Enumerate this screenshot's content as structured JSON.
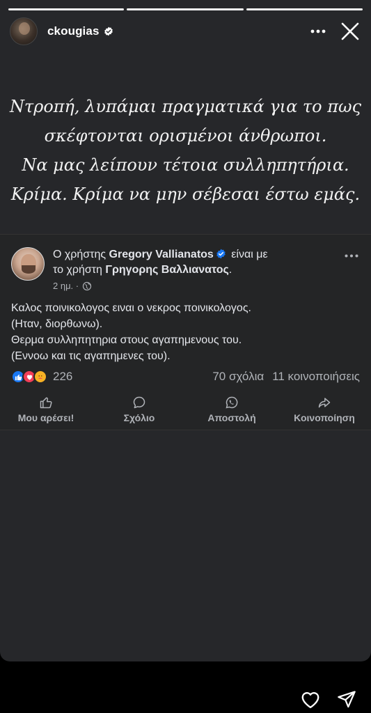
{
  "story": {
    "username": "ckougias",
    "progress_total": 3,
    "progress_current": 3,
    "text_lines": [
      "Ντροπή, λυπάμαι πραγματικά για το πως",
      "σκέφτονται ορισμένοι άνθρωποι.",
      "Να μας λείπουν τέτοια συλληπητήρια.",
      "Κρίμα. Κρίμα να μην σέβεσαι έστω εμάς."
    ]
  },
  "post": {
    "head_prefix": "Ο χρήστης",
    "author": "Gregory Vallianatos",
    "head_mid": "είναι με",
    "head_line2_prefix": "το χρήστη",
    "tagged": "Γρηγορης Βαλλιανατος",
    "head_suffix": ".",
    "time": "2 ημ. ·",
    "body_lines": [
      "Καλος ποινικολογος ειναι ο νεκρος ποινικολογος.",
      "(Ηταν, διορθωνω).",
      "Θερμα συλληπητηρια στους αγαπημενους του.",
      "(Εννοω και τις αγαπημενες του)."
    ],
    "reaction_count": "226",
    "comments": "70 σχόλια",
    "shares": "11 κοινοποιήσεις",
    "actions": {
      "like": "Μου αρέσει!",
      "comment": "Σχόλιο",
      "send": "Αποστολή",
      "share": "Κοινοποίηση"
    }
  },
  "colors": {
    "story_bg": "#26272a",
    "post_bg": "#242526",
    "fb_blue": "#1877f2",
    "muted_text": "#b0b3b8"
  },
  "icons": [
    "verified-icon",
    "more-icon",
    "close-icon",
    "globe-icon",
    "like-icon",
    "comment-icon",
    "whatsapp-icon",
    "share-icon",
    "heart-icon",
    "send-icon"
  ]
}
